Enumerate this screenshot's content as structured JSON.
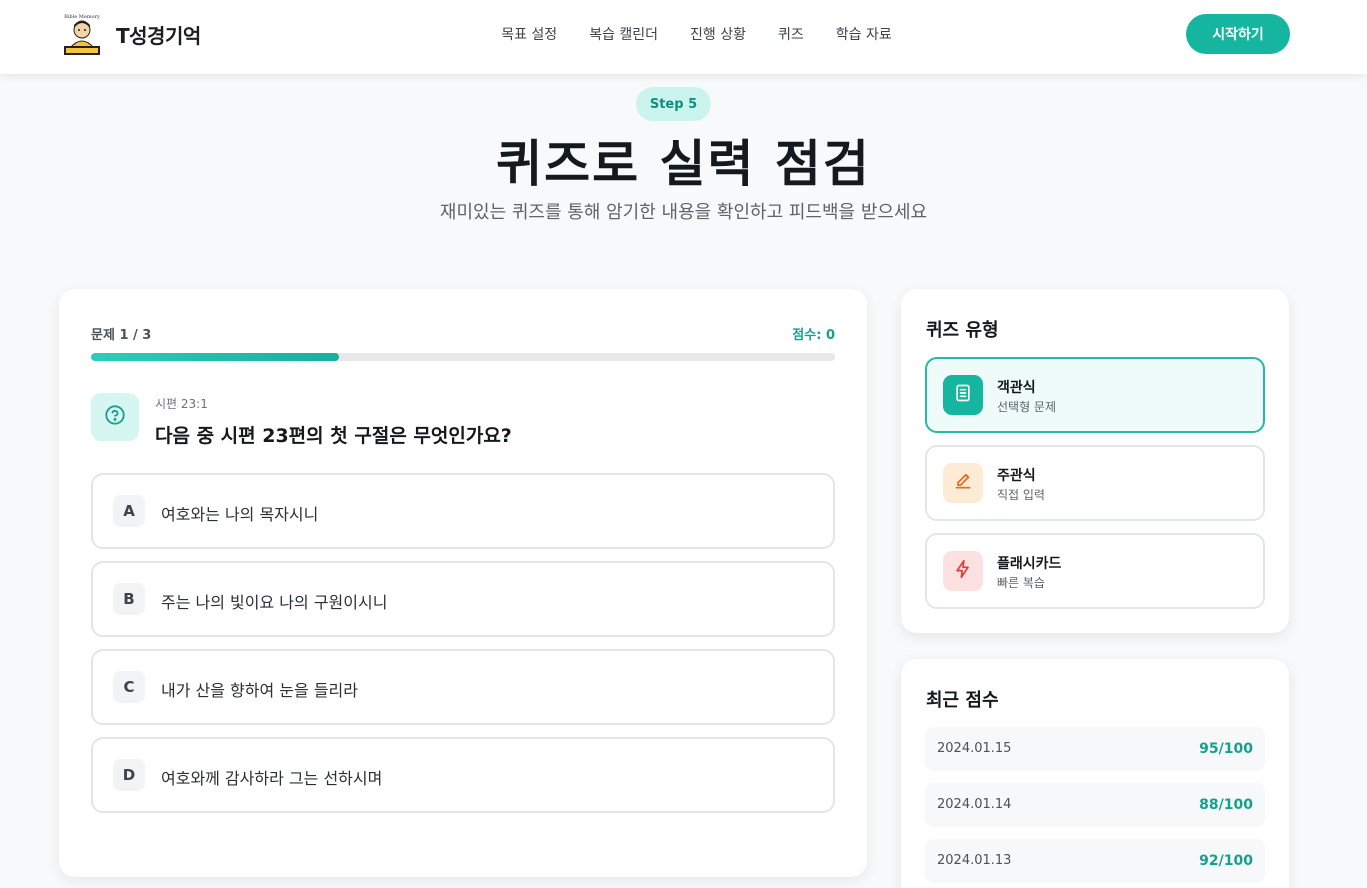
{
  "header": {
    "logo_caption": "Bible Memory",
    "brand": "T성경기억",
    "nav": [
      "목표 설정",
      "복습 캘린더",
      "진행 상황",
      "퀴즈",
      "학습 자료"
    ],
    "start_button": "시작하기"
  },
  "hero": {
    "step": "Step 5",
    "title": "퀴즈로 실력 점검",
    "subtitle": "재미있는 퀴즈를 통해 암기한 내용을 확인하고 피드백을 받으세요"
  },
  "quiz": {
    "progress_label": "문제 1 / 3",
    "score_label": "점수: 0",
    "progress_fraction": 0.333,
    "question_icon": "question-circle-icon",
    "reference": "시편 23:1",
    "question": "다음 중 시편 23편의 첫 구절은 무엇인가요?",
    "options": [
      {
        "letter": "A",
        "text": "여호와는 나의 목자시니"
      },
      {
        "letter": "B",
        "text": "주는 나의 빛이요 나의 구원이시니"
      },
      {
        "letter": "C",
        "text": "내가 산을 향하여 눈을 들리라"
      },
      {
        "letter": "D",
        "text": "여호와께 감사하라 그는 선하시며"
      }
    ]
  },
  "quiz_types": {
    "title": "퀴즈 유형",
    "items": [
      {
        "name": "객관식",
        "desc": "선택형 문제",
        "icon": "document-list-icon",
        "active": true,
        "icon_bg": "#16b5a0",
        "icon_color": "#ffffff"
      },
      {
        "name": "주관식",
        "desc": "직접 입력",
        "icon": "pencil-icon",
        "active": false,
        "icon_bg": "#fdebd6",
        "icon_color": "#e06a1a"
      },
      {
        "name": "플래시카드",
        "desc": "빠른 복습",
        "icon": "lightning-icon",
        "active": false,
        "icon_bg": "#fde0e0",
        "icon_color": "#e03a3a"
      }
    ]
  },
  "recent_scores": {
    "title": "최근 점수",
    "rows": [
      {
        "date": "2024.01.15",
        "score": "95/100"
      },
      {
        "date": "2024.01.14",
        "score": "88/100"
      },
      {
        "date": "2024.01.13",
        "score": "92/100"
      }
    ]
  },
  "colors": {
    "accent": "#16b5a0",
    "accent_light": "#ccf4ee"
  }
}
